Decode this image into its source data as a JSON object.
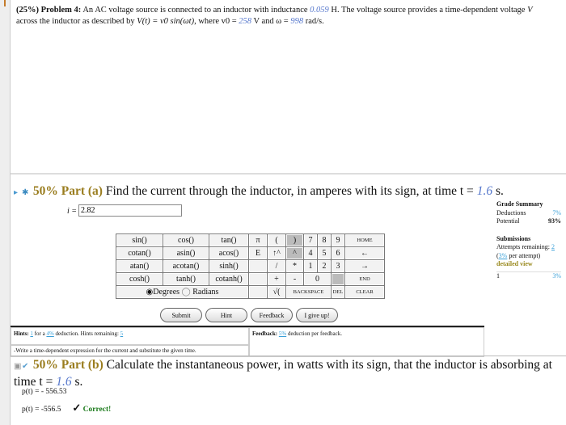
{
  "problem": {
    "prefix": "(25%) Problem 4:",
    "t1": "An AC voltage source is connected to an inductor with inductance",
    "L": "0.059",
    "t2": "H. The voltage source provides a time-dependent voltage",
    "V": "V",
    "t3": "across the inductor as described by",
    "formula": "V(t) = v0 sin(ωt)",
    "t4": ", where v0 =",
    "v0": "258",
    "t5": "V and ω =",
    "omega": "998",
    "t6": "rad/s."
  },
  "part_a": {
    "percent": "50% Part (a)",
    "question": "Find the current through the inductor, in amperes with its sign, at time t =",
    "t": "1.6",
    "unit": "s.",
    "input_label": "i =",
    "input_value": "2.82"
  },
  "grade": {
    "title": "Grade Summary",
    "deductions_label": "Deductions",
    "deductions": "7%",
    "potential_label": "Potential",
    "potential": "93%",
    "sub_title": "Submissions",
    "attempts": "Attempts remaining:",
    "attempts_n": "2",
    "per_attempt_pct": "3%",
    "per_attempt": "per attempt)",
    "detailed": "detailed view",
    "row_n": "1",
    "row_pct": "3%"
  },
  "keypad": {
    "rows": [
      [
        "sin()",
        "cos()",
        "tan()",
        "π",
        "(",
        ")",
        "7",
        "8",
        "9",
        "HOME"
      ],
      [
        "cotan()",
        "asin()",
        "acos()",
        "E",
        "↑^",
        "^",
        "4",
        "5",
        "6",
        "←"
      ],
      [
        "atan()",
        "acotan()",
        "sinh()",
        "",
        "/",
        "*",
        "1",
        "2",
        "3",
        "→"
      ],
      [
        "cosh()",
        "tanh()",
        "cotanh()",
        "",
        "+",
        "-",
        "0",
        "",
        "END"
      ]
    ],
    "degrees": "Degrees",
    "radians": "Radians",
    "sqrt": "√(",
    "backspace": "BACKSPACE",
    "del": "DEL",
    "clear": "CLEAR"
  },
  "buttons": {
    "submit": "Submit",
    "hint": "Hint",
    "feedback": "Feedback",
    "giveup": "I give up!"
  },
  "hints": {
    "label": "Hints:",
    "n": "1",
    "for": "for a",
    "pct": "4%",
    "rest": "deduction. Hints remaining:",
    "remaining": "5",
    "hint_text": "-Write a time-dependent expression for the current and substitute the given time.",
    "fb_label": "Feedback:",
    "fb_pct": "5%",
    "fb_rest": "deduction per feedback."
  },
  "part_b": {
    "percent": "50% Part (b)",
    "question": "Calculate the instantaneous power, in watts with its sign, that the inductor is absorbing at time t =",
    "t": "1.6",
    "unit": "s.",
    "ans1": "p(t) = - 556.53",
    "ans2": "p(t) = -556.5",
    "correct": "Correct!"
  }
}
